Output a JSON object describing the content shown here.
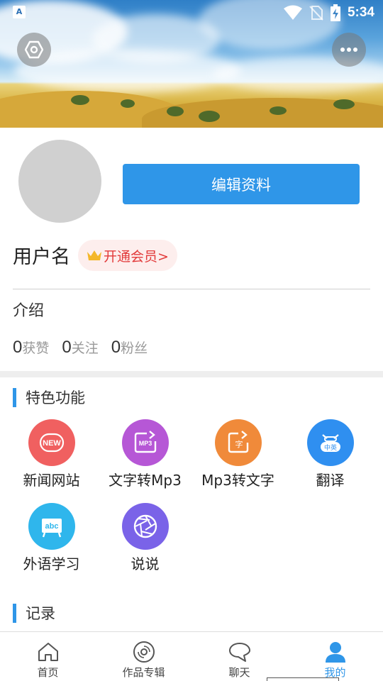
{
  "status_bar": {
    "time": "5:34",
    "app_icon_glyph": "A",
    "icons": [
      "app-notification-icon",
      "wifi-icon",
      "no-sim-icon",
      "battery-charging-icon"
    ]
  },
  "header": {
    "left_button_icon": "settings-icon",
    "right_button_icon": "more-icon"
  },
  "profile": {
    "edit_button_label": "编辑资料",
    "username": "用户名",
    "vip_label": "开通会员>",
    "vip_icon": "crown-icon",
    "intro_label": "介绍",
    "stats": [
      {
        "count": "0",
        "label": "获赞"
      },
      {
        "count": "0",
        "label": "关注"
      },
      {
        "count": "0",
        "label": "粉丝"
      }
    ]
  },
  "features_section": {
    "title": "特色功能",
    "items": [
      {
        "label": "新闻网站",
        "icon": "news-icon",
        "icon_text": "NEW",
        "color": "#f06060"
      },
      {
        "label": "文字转Mp3",
        "icon": "text-to-mp3-icon",
        "icon_text": "MP3",
        "color": "#b657d6"
      },
      {
        "label": "Mp3转文字",
        "icon": "mp3-to-text-icon",
        "icon_text": "字",
        "color": "#f08a3a"
      },
      {
        "label": "翻译",
        "icon": "translate-icon",
        "icon_text": "中英",
        "color": "#2f8ff0"
      },
      {
        "label": "外语学习",
        "icon": "foreign-language-icon",
        "icon_text": "abc",
        "color": "#2fb6ec"
      },
      {
        "label": "说说",
        "icon": "shutter-icon",
        "icon_text": "",
        "color": "#7a63e8"
      }
    ]
  },
  "records_section": {
    "title": "记录"
  },
  "bottom_nav": {
    "items": [
      {
        "label": "首页",
        "icon": "home-icon",
        "active": false
      },
      {
        "label": "作品专辑",
        "icon": "album-disc-icon",
        "active": false
      },
      {
        "label": "聊天",
        "icon": "chat-bubble-icon",
        "active": false
      },
      {
        "label": "我的",
        "icon": "person-icon",
        "active": true
      }
    ]
  },
  "colors": {
    "accent": "#2f96e8",
    "vip_text": "#e23a3a",
    "vip_bg": "#fdeeed"
  }
}
